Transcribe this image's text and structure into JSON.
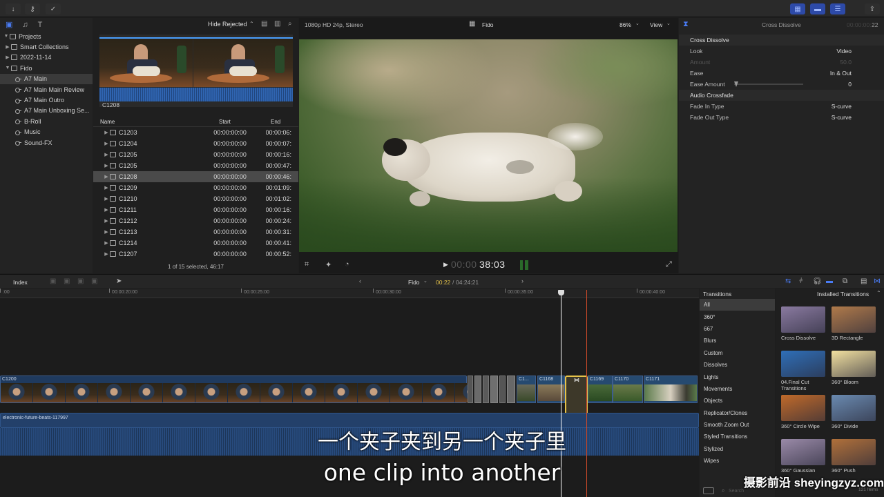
{
  "toolbar": {
    "left_icons": [
      "import-icon",
      "keyword-icon",
      "check-icon"
    ],
    "right_icons": [
      "layout-browser-icon",
      "layout-timeline-icon",
      "layout-inspector-icon",
      "share-icon"
    ]
  },
  "browser": {
    "filter_label": "Hide Rejected",
    "filmstrip_clip": "C1208",
    "status": "1 of 15 selected, 46:17",
    "columns": [
      "Name",
      "Start",
      "End"
    ],
    "rows": [
      {
        "name": "C1203",
        "start": "00:00:00:00",
        "end": "00:00:06:"
      },
      {
        "name": "C1204",
        "start": "00:00:00:00",
        "end": "00:00:07:"
      },
      {
        "name": "C1205",
        "start": "00:00:00:00",
        "end": "00:00:16:"
      },
      {
        "name": "C1205",
        "start": "00:00:00:00",
        "end": "00:00:47:"
      },
      {
        "name": "C1208",
        "start": "00:00:00:00",
        "end": "00:00:46:"
      },
      {
        "name": "C1209",
        "start": "00:00:00:00",
        "end": "00:01:09:"
      },
      {
        "name": "C1210",
        "start": "00:00:00:00",
        "end": "00:01:02:"
      },
      {
        "name": "C1211",
        "start": "00:00:00:00",
        "end": "00:00:16:"
      },
      {
        "name": "C1212",
        "start": "00:00:00:00",
        "end": "00:00:24:"
      },
      {
        "name": "C1213",
        "start": "00:00:00:00",
        "end": "00:00:31:"
      },
      {
        "name": "C1214",
        "start": "00:00:00:00",
        "end": "00:00:41:"
      },
      {
        "name": "C1207",
        "start": "00:00:00:00",
        "end": "00:00:52:"
      }
    ],
    "selected_index": 4
  },
  "library": {
    "items": [
      {
        "label": "Projects",
        "type": "folder"
      },
      {
        "label": "Smart Collections",
        "type": "event"
      },
      {
        "label": "2022-11-14",
        "type": "event"
      },
      {
        "label": "Fido",
        "type": "event"
      },
      {
        "label": "A7 Main",
        "type": "keyword"
      },
      {
        "label": "A7 Main Main Review",
        "type": "keyword"
      },
      {
        "label": "A7 Main Outro",
        "type": "keyword"
      },
      {
        "label": "A7 Main Unboxing Se...",
        "type": "keyword"
      },
      {
        "label": "B-Roll",
        "type": "keyword"
      },
      {
        "label": "Music",
        "type": "keyword"
      },
      {
        "label": "Sound-FX",
        "type": "keyword"
      }
    ],
    "selected_index": 4
  },
  "viewer": {
    "format": "1080p HD 24p, Stereo",
    "title": "Fido",
    "zoom": "86%",
    "view_label": "View",
    "timecode_dim": "00:00",
    "timecode": "38:03"
  },
  "inspector": {
    "title": "Cross Dissolve",
    "duration_dim": "00:00:00:",
    "duration": "22",
    "section1": "Cross Dissolve",
    "rows1": [
      {
        "label": "Look",
        "value": "Video"
      },
      {
        "label": "Amount",
        "value": "50.0",
        "dim": true
      },
      {
        "label": "Ease",
        "value": "In & Out"
      },
      {
        "label": "Ease Amount",
        "value": "0"
      }
    ],
    "section2": "Audio Crossfade",
    "rows2": [
      {
        "label": "Fade In Type",
        "value": "S-curve"
      },
      {
        "label": "Fade Out Type",
        "value": "S-curve"
      }
    ]
  },
  "timeline": {
    "index_label": "Index",
    "project": "Fido",
    "position": "00:22",
    "duration": "04:24:21",
    "ruler": [
      ":00",
      "00:00:20:00",
      "00:00:25:00",
      "00:00:30:00",
      "00:00:35:00",
      "00:00:40:00"
    ],
    "main_clip": "C1200",
    "small_clips": [
      "C1...",
      "C1168",
      "C1169",
      "C1170",
      "C1171"
    ],
    "audio_clip": "electronic-future-beats-117997"
  },
  "transitions": {
    "header": "Transitions",
    "installed": "Installed Transitions",
    "categories": [
      "All",
      "360°",
      "667",
      "Blurs",
      "Custom",
      "Dissolves",
      "Lights",
      "Movements",
      "Objects",
      "Replicator/Clones",
      "Smooth Zoom Out",
      "Styled Transitions",
      "Stylized",
      "Wipes"
    ],
    "selected_index": 0,
    "items": [
      {
        "label": "Cross Dissolve",
        "color": "#8a7aa0"
      },
      {
        "label": "3D Rectangle",
        "color": "#b07a4a"
      },
      {
        "label": "04.Final Cut Transitions",
        "color": "#2f6fb8"
      },
      {
        "label": "360° Bloom",
        "color": "#f2e0a0"
      },
      {
        "label": "360° Circle Wipe",
        "color": "#c06a2a"
      },
      {
        "label": "360° Divide",
        "color": "#6a8ab0"
      },
      {
        "label": "360° Gaussian",
        "color": "#9a8aa8"
      },
      {
        "label": "360° Push",
        "color": "#b0703a"
      }
    ],
    "count": "121 Items",
    "search_placeholder": "Search"
  },
  "subtitles": {
    "chinese": "一个夹子夹到另一个夹子里",
    "english": "one clip into another"
  },
  "watermark": "摄影前沿 sheyingzyz.com",
  "colors": {
    "accent_blue": "#3a6cf0",
    "playhead": "#ffffff",
    "skimmer": "#e05a3a",
    "selection_yellow": "#e6c34a",
    "clip_blue": "#2a4a78",
    "audio_blue": "#2b5aa0"
  }
}
